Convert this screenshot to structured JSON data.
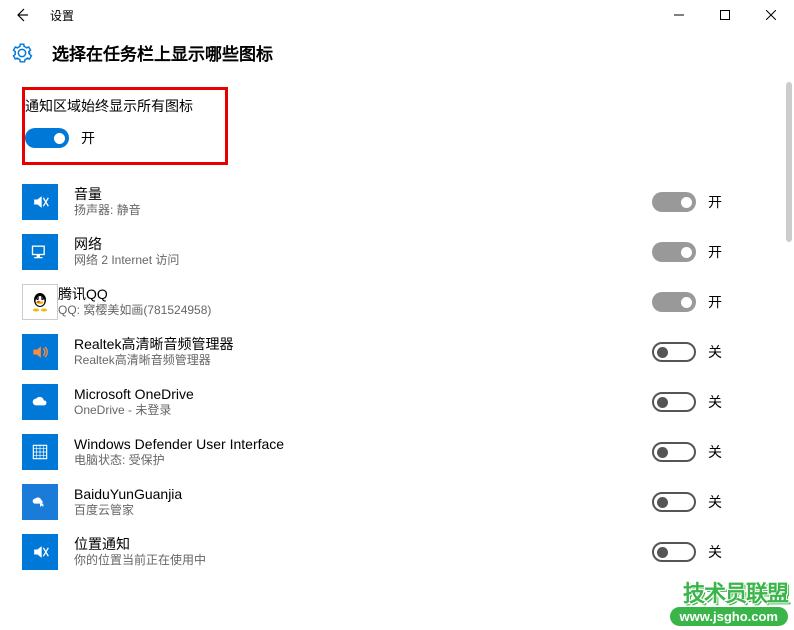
{
  "window": {
    "title": "设置"
  },
  "page": {
    "heading": "选择在任务栏上显示哪些图标"
  },
  "master": {
    "label": "通知区域始终显示所有图标",
    "state_text": "开",
    "on": true
  },
  "state_labels": {
    "on": "开",
    "off": "关"
  },
  "items": [
    {
      "id": "volume",
      "title": "音量",
      "subtitle": "扬声器: 静音",
      "on": true,
      "disabled": true
    },
    {
      "id": "network",
      "title": "网络",
      "subtitle": "网络 2 Internet 访问",
      "on": true,
      "disabled": true
    },
    {
      "id": "qq",
      "title": "腾讯QQ",
      "subtitle": "QQ: 窝樱美如画(781524958)",
      "on": true,
      "disabled": true
    },
    {
      "id": "realtek",
      "title": "Realtek高清晰音频管理器",
      "subtitle": "Realtek高清晰音频管理器",
      "on": false,
      "disabled": true
    },
    {
      "id": "onedrive",
      "title": "Microsoft OneDrive",
      "subtitle": "OneDrive - 未登录",
      "on": false,
      "disabled": true
    },
    {
      "id": "defender",
      "title": "Windows Defender User Interface",
      "subtitle": "电脑状态: 受保护",
      "on": false,
      "disabled": true
    },
    {
      "id": "baidu",
      "title": "BaiduYunGuanjia",
      "subtitle": "百度云管家",
      "on": false,
      "disabled": true
    },
    {
      "id": "location",
      "title": "位置通知",
      "subtitle": "你的位置当前正在使用中",
      "on": false,
      "disabled": true
    }
  ],
  "watermark": {
    "l1": "技术员联盟",
    "l2": "www.jsgho.com"
  }
}
